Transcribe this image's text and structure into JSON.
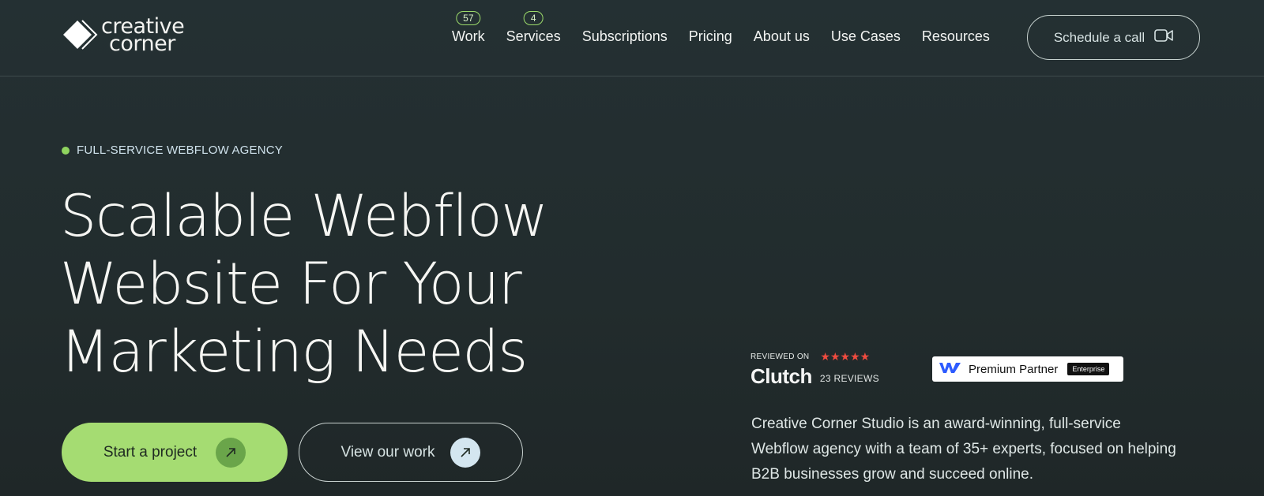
{
  "brand": {
    "line1": "creative",
    "line2": "corner"
  },
  "nav": [
    {
      "label": "Work",
      "badge": "57"
    },
    {
      "label": "Services",
      "badge": "4"
    },
    {
      "label": "Subscriptions"
    },
    {
      "label": "Pricing"
    },
    {
      "label": "About us"
    },
    {
      "label": "Use Cases"
    },
    {
      "label": "Resources"
    }
  ],
  "header_cta": {
    "label": "Schedule a call",
    "icon": "video-camera-icon"
  },
  "hero": {
    "eyebrow": "FULL-SERVICE WEBFLOW AGENCY",
    "headline": [
      "Scalable Webflow",
      "Website For Your",
      "Marketing Needs"
    ],
    "primary_button": "Start a project",
    "secondary_button": "View our work"
  },
  "clutch": {
    "reviewed_on": "REVIEWED ON",
    "stars": "★★★★★",
    "logo": "Clutch",
    "reviews": "23 REVIEWS"
  },
  "partner": {
    "label": "Premium Partner",
    "badge": "Enterprise"
  },
  "description": "Creative Corner Studio is an award-winning, full-service Webflow agency with a team of 35+ experts, focused on helping B2B businesses grow and succeed online.",
  "colors": {
    "background": "#242f30",
    "accent_green": "#a5dc72",
    "star_red": "#ef4b3f"
  }
}
